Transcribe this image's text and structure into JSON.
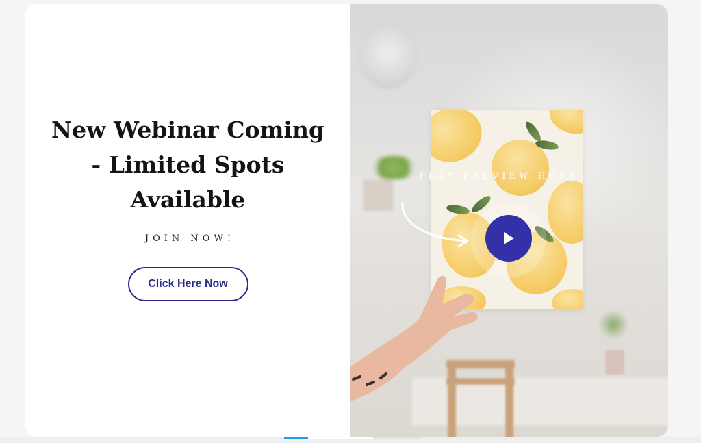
{
  "hero": {
    "headline": "New Webinar Coming - Limited Spots Available",
    "subheading": "JOIN NOW!",
    "cta_label": "Click Here Now"
  },
  "media": {
    "preview_label": "PLAY PREVIEW HERE",
    "play_icon": "play-icon"
  },
  "colors": {
    "accent": "#3430a7",
    "cta_border": "#2c2a8c",
    "indicator_active": "#1aa3e0"
  }
}
